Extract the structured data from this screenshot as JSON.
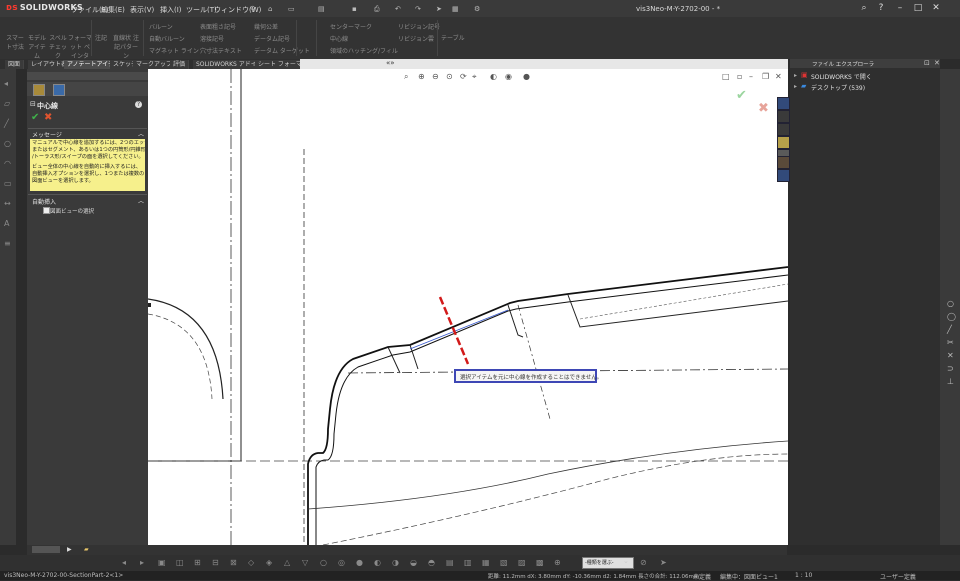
{
  "app": {
    "brand": "SOLIDWORKS",
    "doc_title": "vis3Neo-M-Y-2702-00 - *"
  },
  "menu": [
    "ファイル(F)",
    "編集(E)",
    "表示(V)",
    "挿入(I)",
    "ツール(T)",
    "ウィンドウ(W)"
  ],
  "commands": [
    {
      "label": "スマート寸法"
    },
    {
      "label": "モデル アイテム"
    },
    {
      "label": "スペル チェック"
    },
    {
      "label": "フォーマット ペインタ"
    },
    {
      "label": "注記"
    },
    {
      "label": "直線状 注記パターン"
    },
    {
      "label": "バルーン"
    },
    {
      "label": "自動バルーン"
    },
    {
      "label": "マグネット ライン"
    },
    {
      "label": "表面粗さ記号"
    },
    {
      "label": "溶接記号"
    },
    {
      "label": "穴寸法テキスト"
    },
    {
      "label": "幾何公差"
    },
    {
      "label": "データム記号"
    },
    {
      "label": "データム ターゲット"
    },
    {
      "label": "センターマーク"
    },
    {
      "label": "中心線"
    },
    {
      "label": "領域のハッチング/フィル"
    },
    {
      "label": "リビジョン記号"
    },
    {
      "label": "リビジョン雲"
    },
    {
      "label": "テーブル"
    }
  ],
  "tabs": [
    {
      "label": "図面",
      "active": false
    },
    {
      "label": "レイアウト表示",
      "active": false
    },
    {
      "label": "アノテートアイテム",
      "active": true
    },
    {
      "label": "スケッチ",
      "active": false
    },
    {
      "label": "マークアップ",
      "active": false
    },
    {
      "label": "評価",
      "active": false
    },
    {
      "label": "SOLIDWORKS アドイン",
      "active": false
    },
    {
      "label": "シート フォーマット",
      "active": false
    }
  ],
  "property_manager": {
    "title": "中心線",
    "message_title": "メッセージ",
    "message_lines": [
      "マニュアルで中心線を追加するには、2つのエッジ",
      "またはセグメント、あるいは1つの円筒形/円錐形",
      "/トーラス形/スイープの面を選択してください。",
      "",
      "ビュー全体の中心線を自動的に挿入するには、",
      "自動挿入オプションを選択し、1つまたは複数の",
      "図面ビューを選択します。"
    ],
    "auto_title": "自動挿入",
    "auto_option": "図面ビューの選択",
    "auto_checked": false
  },
  "tooltip": "選択アイテムを元に中心線を作成することはできません。",
  "task_pane": {
    "title": "ファイル エクスプローラ",
    "items": [
      "SOLIDWORKS で開く",
      "デスクトップ (539)"
    ]
  },
  "bottom": {
    "select_filter": "-種類を選ぶ-"
  },
  "status": {
    "file": "vis3Neo-M-Y-2702-00-SectionPart-2<1>",
    "readout": "距離: 11.2mm  dX: 3.80mm  dY: -10.36mm  d2: 1.84mm 長さの合計: 112.06mm",
    "state": "未定義",
    "editing": "編集中：図面ビュー1",
    "scale": "1 : 10",
    "units": "ユーザー定義"
  }
}
